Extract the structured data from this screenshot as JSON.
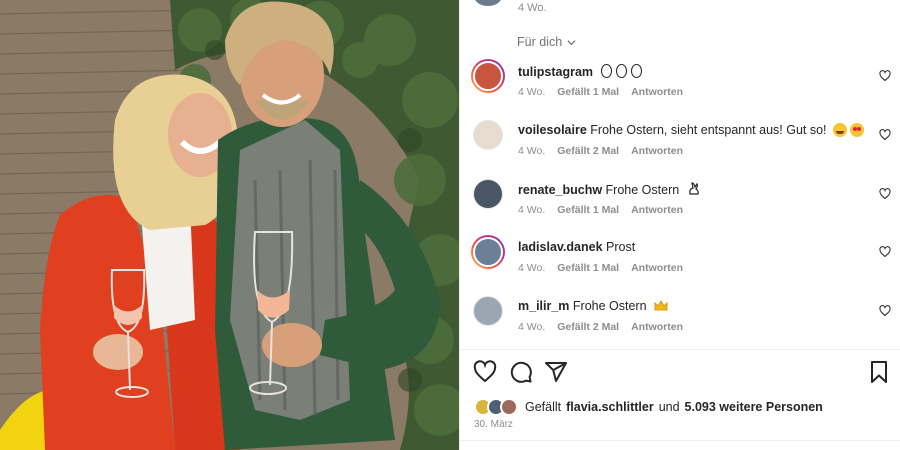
{
  "top": {
    "time": "4 Wo."
  },
  "filter": {
    "label": "Für dich"
  },
  "comments": [
    {
      "user": "tulipstagram",
      "text": "",
      "emoji": "three-empty-circles",
      "time": "4 Wo.",
      "likes": "Gefällt 1 Mal",
      "reply": "Antworten",
      "avatar_color": "#c8553d"
    },
    {
      "user": "voilesolaire",
      "text": "Frohe Ostern, sieht entspannt aus! Gut so!",
      "emoji": "grin-face heart-eyes-face",
      "time": "4 Wo.",
      "likes": "Gefällt 2 Mal",
      "reply": "Antworten",
      "avatar_color": "#e8dcd0"
    },
    {
      "user": "renate_buchw",
      "text": "Frohe Ostern",
      "emoji": "rabbit-outline",
      "time": "4 Wo.",
      "likes": "Gefällt 1 Mal",
      "reply": "Antworten",
      "avatar_color": "#4a5663"
    },
    {
      "user": "ladislav.danek",
      "text": "Prost",
      "emoji": "",
      "time": "4 Wo.",
      "likes": "Gefällt 1 Mal",
      "reply": "Antworten",
      "avatar_color": "#6c7f96"
    },
    {
      "user": "m_ilir_m",
      "text": "Frohe Ostern",
      "emoji": "crown",
      "time": "4 Wo.",
      "likes": "Gefällt 2 Mal",
      "reply": "Antworten",
      "avatar_color": "#9aa6b2"
    }
  ],
  "likes": {
    "prefix": "Gefällt",
    "user": "flavia.schlittler",
    "connector": "und",
    "count_text": "5.093 weitere Personen"
  },
  "date": "30. März",
  "colors": {
    "text": "#262626",
    "meta": "#8e8e8e",
    "story_ring_start": "#fdc468",
    "story_ring_end": "#833ab4"
  },
  "icons": [
    "heart-icon",
    "comment-icon",
    "share-icon",
    "bookmark-icon",
    "chevron-down-icon"
  ]
}
